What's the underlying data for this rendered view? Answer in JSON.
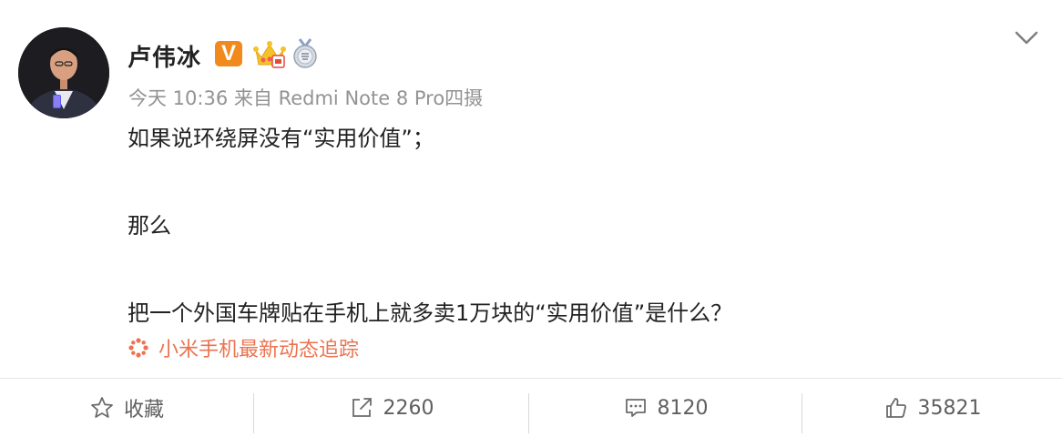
{
  "post": {
    "author": "卢伟冰",
    "verified_mark": "V",
    "timestamp": "今天 10:36",
    "source_prefix": "来自",
    "source_device": "Redmi Note 8 Pro四摄",
    "content_lines": [
      "如果说环绕屏没有“实用价值”；",
      "那么",
      "把一个外国车牌贴在手机上就多卖1万块的“实用价值”是什么？"
    ],
    "topic_link": "小米手机最新动态追踪"
  },
  "actions": {
    "favorite_label": "收藏",
    "repost_count": "2260",
    "comment_count": "8120",
    "like_count": "35821"
  },
  "colors": {
    "topic": "#eb7350",
    "verified": "#f08a1c",
    "meta_text": "#939393"
  },
  "icons": [
    "chevron-down-icon",
    "crown-badge-icon",
    "medal-badge-icon",
    "topic-flower-icon",
    "star-icon",
    "repost-icon",
    "comment-icon",
    "like-icon"
  ]
}
